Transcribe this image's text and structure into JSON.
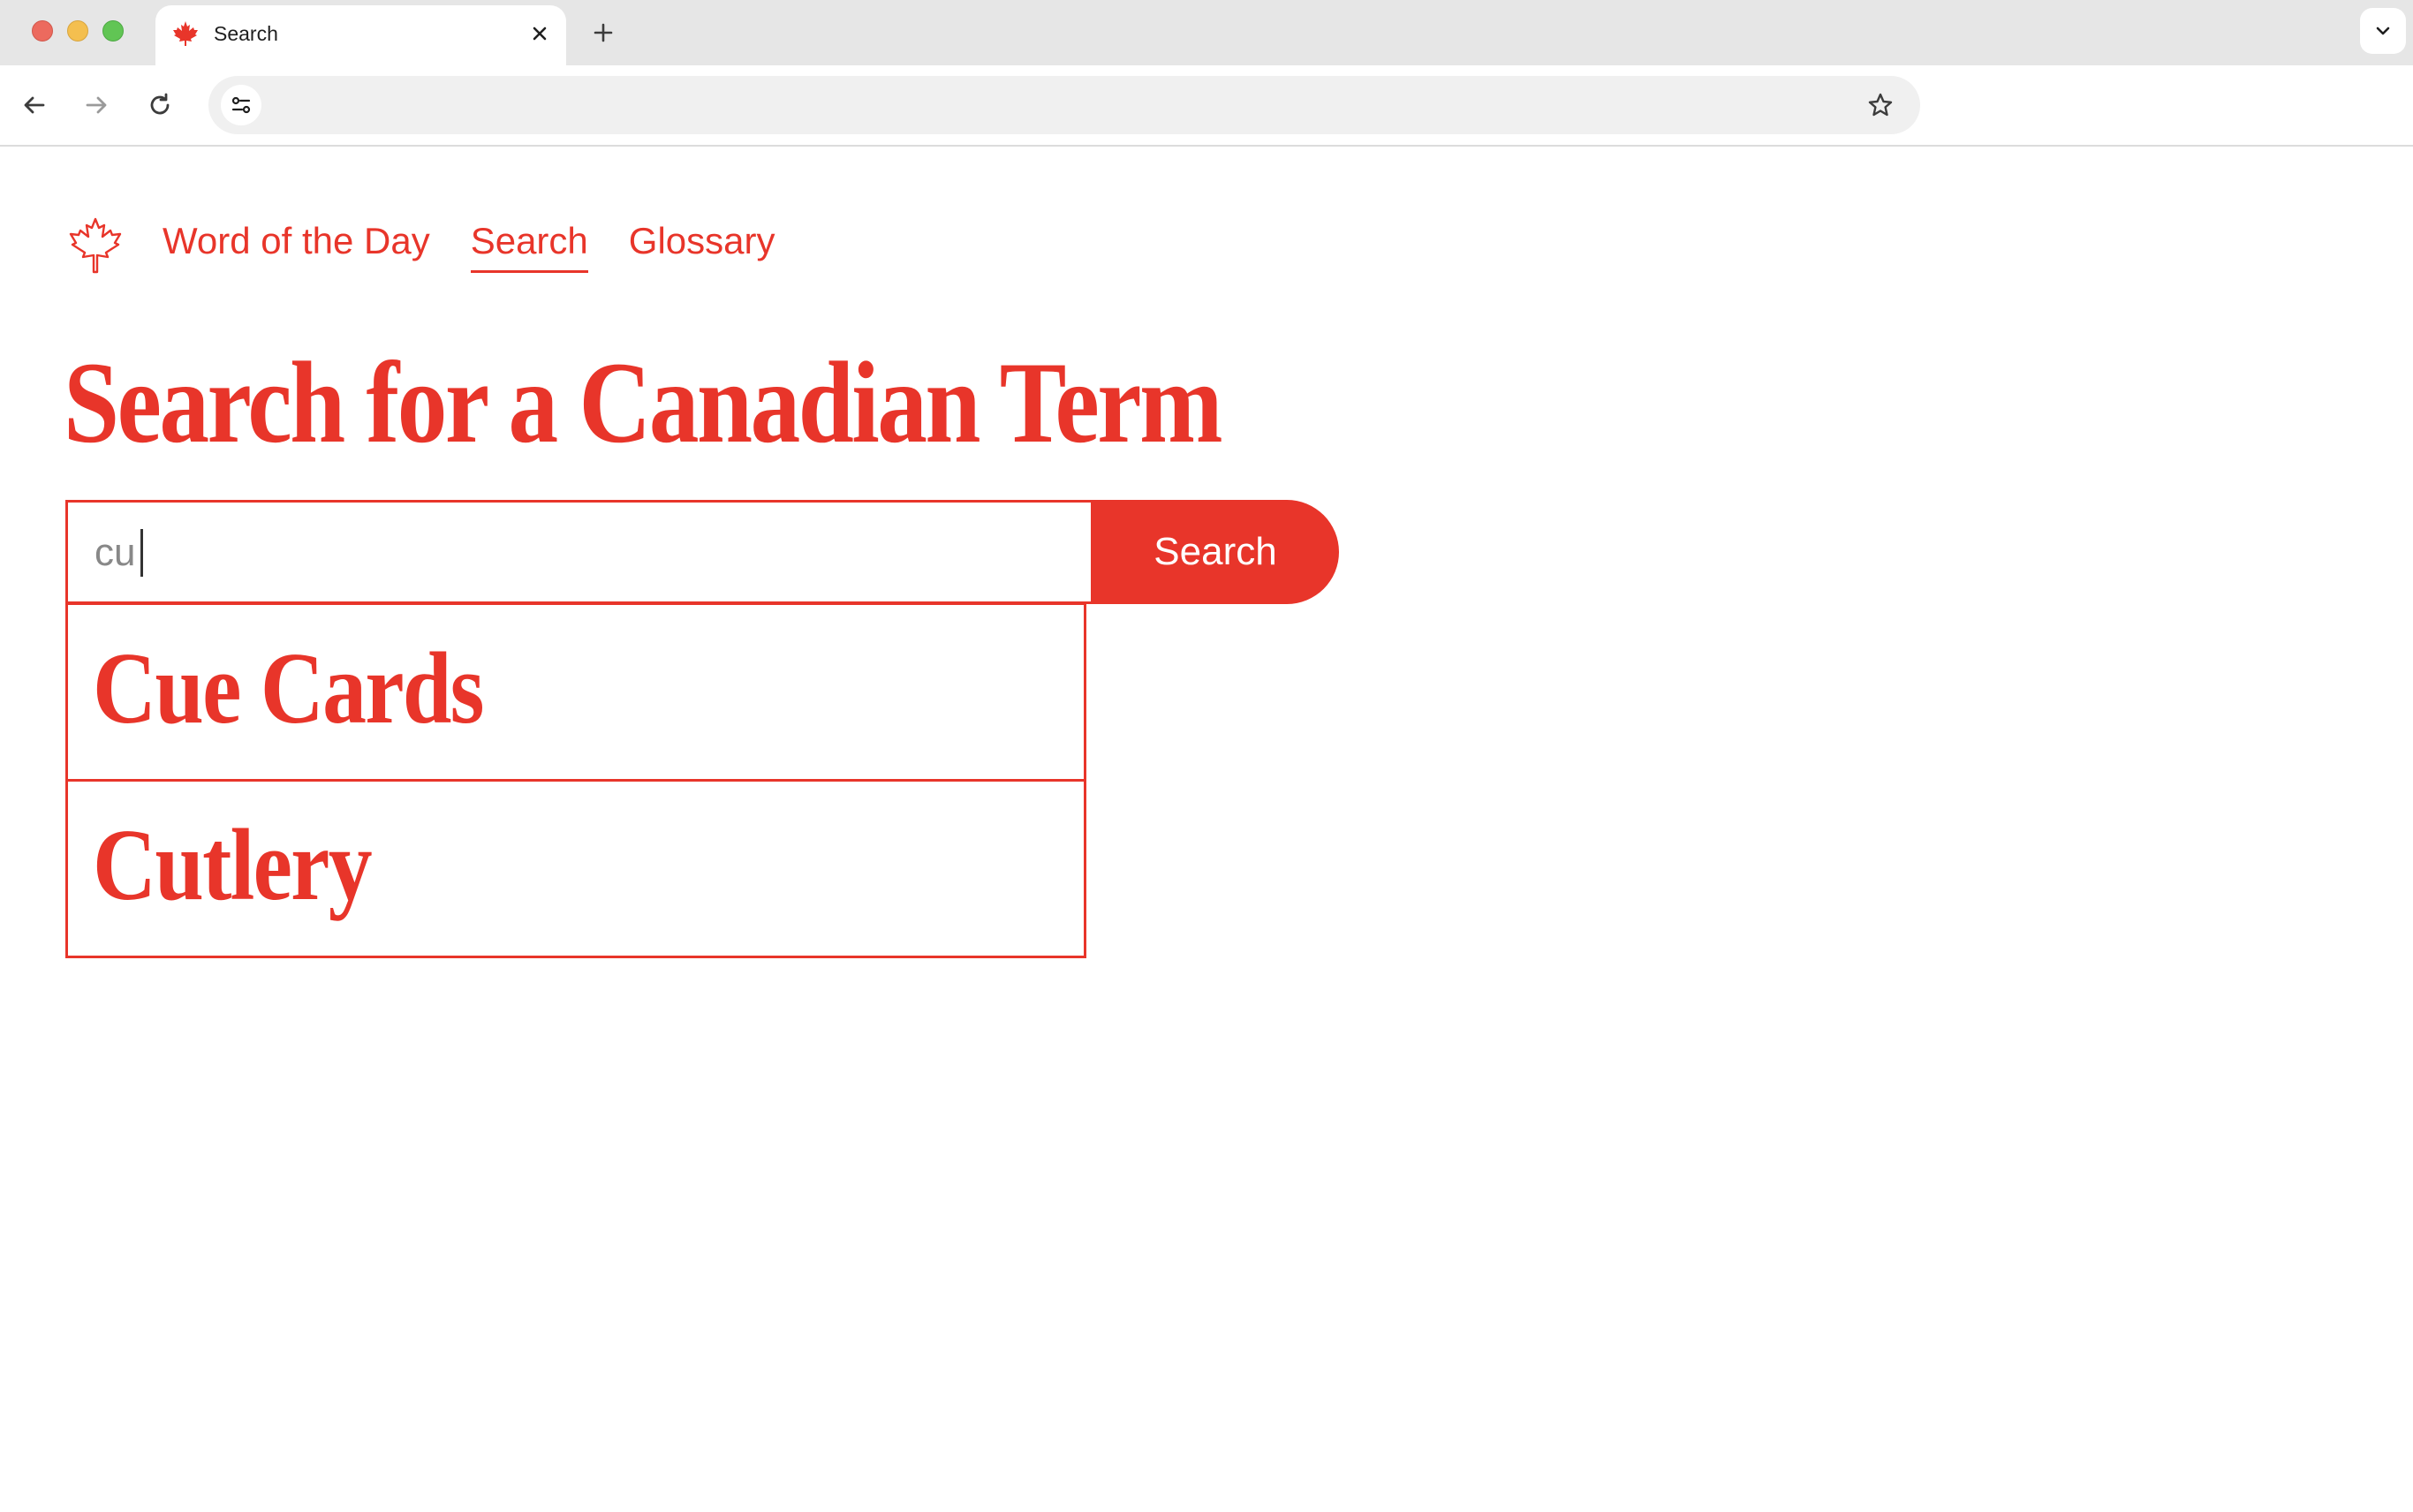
{
  "browser": {
    "tab": {
      "title": "Search",
      "favicon_icon": "maple-leaf-icon"
    },
    "address_bar": {
      "value": "",
      "placeholder": ""
    },
    "icons": {
      "close_tab": "close-icon",
      "new_tab": "plus-icon",
      "tab_menu": "chevron-down-icon",
      "back": "arrow-left-icon",
      "forward": "arrow-right-icon",
      "reload": "reload-icon",
      "site_info": "tune-icon",
      "bookmark": "star-icon"
    }
  },
  "site": {
    "logo_icon": "maple-leaf-outline-icon",
    "nav": {
      "items": [
        {
          "label": "Word of the Day",
          "active": false
        },
        {
          "label": "Search",
          "active": true
        },
        {
          "label": "Glossary",
          "active": false
        }
      ]
    }
  },
  "main": {
    "title": "Search for a Canadian Term",
    "search": {
      "value": "cu",
      "button_label": "Search"
    },
    "suggestions": [
      {
        "label": "Cue Cards"
      },
      {
        "label": "Cutlery"
      }
    ]
  },
  "colors": {
    "accent": "#e8352a",
    "input_text": "#888888",
    "chrome_bg": "#e6e6e6",
    "omnibox_bg": "#f0f0f0"
  }
}
